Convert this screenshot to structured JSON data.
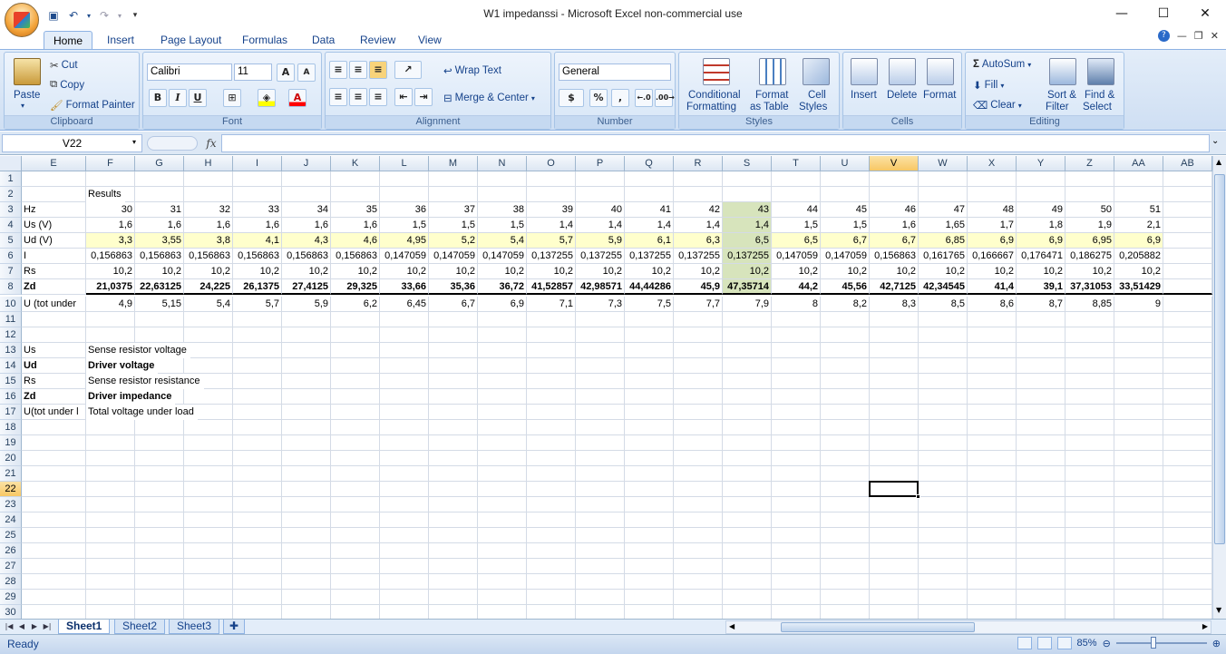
{
  "title": "W1 impedanssi - Microsoft Excel non-commercial use",
  "ribbon_tabs": [
    "Home",
    "Insert",
    "Page Layout",
    "Formulas",
    "Data",
    "Review",
    "View"
  ],
  "ribbon": {
    "clipboard": {
      "paste": "Paste",
      "cut": "Cut",
      "copy": "Copy",
      "format_painter": "Format Painter",
      "label": "Clipboard"
    },
    "font": {
      "name": "Calibri",
      "size": "11",
      "label": "Font",
      "bold": "B",
      "italic": "I",
      "underline": "U",
      "grow": "A",
      "shrink": "A",
      "color_letter": "A"
    },
    "alignment": {
      "wrap": "Wrap Text",
      "merge": "Merge & Center",
      "label": "Alignment"
    },
    "number": {
      "format": "General",
      "percent": "%",
      "comma": ",",
      "label": "Number"
    },
    "styles": {
      "conditional1": "Conditional",
      "conditional2": "Formatting",
      "table1": "Format",
      "table2": "as Table",
      "cell1": "Cell",
      "cell2": "Styles",
      "label": "Styles"
    },
    "cells": {
      "insert": "Insert",
      "delete": "Delete",
      "format": "Format",
      "label": "Cells"
    },
    "editing": {
      "autosum": "AutoSum",
      "fill": "Fill",
      "clear": "Clear",
      "sort1": "Sort &",
      "sort2": "Filter",
      "find1": "Find &",
      "find2": "Select",
      "label": "Editing"
    }
  },
  "name_box": "V22",
  "fx_label": "fx",
  "columns": [
    "E",
    "F",
    "G",
    "H",
    "I",
    "J",
    "K",
    "L",
    "M",
    "N",
    "O",
    "P",
    "Q",
    "R",
    "S",
    "T",
    "U",
    "V",
    "W",
    "X",
    "Y",
    "Z",
    "AA",
    "AB"
  ],
  "selected_column": "V",
  "selected_row": "22",
  "rows": [
    {
      "n": "1",
      "label": "",
      "vals": []
    },
    {
      "n": "2",
      "label": "",
      "vals": []
    },
    {
      "n": "3",
      "label": "Hz",
      "vals": [
        "30",
        "31",
        "32",
        "33",
        "34",
        "35",
        "36",
        "37",
        "38",
        "39",
        "40",
        "41",
        "42",
        "43",
        "44",
        "45",
        "46",
        "47",
        "48",
        "49",
        "50",
        "51"
      ]
    },
    {
      "n": "4",
      "label": "Us (V)",
      "vals": [
        "1,6",
        "1,6",
        "1,6",
        "1,6",
        "1,6",
        "1,6",
        "1,5",
        "1,5",
        "1,5",
        "1,4",
        "1,4",
        "1,4",
        "1,4",
        "1,4",
        "1,5",
        "1,5",
        "1,6",
        "1,65",
        "1,7",
        "1,8",
        "1,9",
        "2,1"
      ]
    },
    {
      "n": "5",
      "label": "Ud (V)",
      "vals": [
        "3,3",
        "3,55",
        "3,8",
        "4,1",
        "4,3",
        "4,6",
        "4,95",
        "5,2",
        "5,4",
        "5,7",
        "5,9",
        "6,1",
        "6,3",
        "6,5",
        "6,5",
        "6,7",
        "6,7",
        "6,85",
        "6,9",
        "6,9",
        "6,95",
        "6,9"
      ]
    },
    {
      "n": "6",
      "label": "I",
      "vals": [
        "0,156863",
        "0,156863",
        "0,156863",
        "0,156863",
        "0,156863",
        "0,156863",
        "0,147059",
        "0,147059",
        "0,147059",
        "0,137255",
        "0,137255",
        "0,137255",
        "0,137255",
        "0,137255",
        "0,147059",
        "0,147059",
        "0,156863",
        "0,161765",
        "0,166667",
        "0,176471",
        "0,186275",
        "0,205882"
      ]
    },
    {
      "n": "7",
      "label": "Rs",
      "vals": [
        "10,2",
        "10,2",
        "10,2",
        "10,2",
        "10,2",
        "10,2",
        "10,2",
        "10,2",
        "10,2",
        "10,2",
        "10,2",
        "10,2",
        "10,2",
        "10,2",
        "10,2",
        "10,2",
        "10,2",
        "10,2",
        "10,2",
        "10,2",
        "10,2",
        "10,2"
      ]
    },
    {
      "n": "8",
      "label": "Zd",
      "vals": [
        "21,0375",
        "22,63125",
        "24,225",
        "26,1375",
        "27,4125",
        "29,325",
        "33,66",
        "35,36",
        "36,72",
        "41,52857",
        "42,98571",
        "44,44286",
        "45,9",
        "47,35714",
        "44,2",
        "45,56",
        "42,7125",
        "42,34545",
        "41,4",
        "39,1",
        "37,31053",
        "33,51429"
      ]
    },
    {
      "n": "10",
      "label": "U (tot under",
      "vals": [
        "4,9",
        "5,15",
        "5,4",
        "5,7",
        "5,9",
        "6,2",
        "6,45",
        "6,7",
        "6,9",
        "7,1",
        "7,3",
        "7,5",
        "7,7",
        "7,9",
        "8",
        "8,2",
        "8,3",
        "8,5",
        "8,6",
        "8,7",
        "8,85",
        "9"
      ]
    },
    {
      "n": "11",
      "label": "",
      "vals": []
    },
    {
      "n": "12",
      "label": "",
      "vals": []
    },
    {
      "n": "13",
      "label": "Us",
      "vals": []
    },
    {
      "n": "14",
      "label": "Ud",
      "vals": []
    },
    {
      "n": "15",
      "label": "Rs",
      "vals": []
    },
    {
      "n": "16",
      "label": "Zd",
      "vals": []
    },
    {
      "n": "17",
      "label": "U(tot under l",
      "vals": []
    },
    {
      "n": "18",
      "label": "",
      "vals": []
    },
    {
      "n": "19",
      "label": "",
      "vals": []
    },
    {
      "n": "20",
      "label": "",
      "vals": []
    },
    {
      "n": "21",
      "label": "",
      "vals": []
    },
    {
      "n": "22",
      "label": "",
      "vals": []
    },
    {
      "n": "23",
      "label": "",
      "vals": []
    },
    {
      "n": "24",
      "label": "",
      "vals": []
    },
    {
      "n": "25",
      "label": "",
      "vals": []
    },
    {
      "n": "26",
      "label": "",
      "vals": []
    },
    {
      "n": "27",
      "label": "",
      "vals": []
    },
    {
      "n": "28",
      "label": "",
      "vals": []
    },
    {
      "n": "29",
      "label": "",
      "vals": []
    },
    {
      "n": "30",
      "label": "",
      "vals": []
    }
  ],
  "f_column_text": {
    "2": "Results",
    "13": "Sense resistor voltage",
    "14": "Driver voltage",
    "15": "Sense resistor resistance",
    "16": "Driver impedance",
    "17": "Total voltage under load"
  },
  "bold_rows": [
    "8",
    "14",
    "16"
  ],
  "sheets": [
    "Sheet1",
    "Sheet2",
    "Sheet3"
  ],
  "active_sheet": "Sheet1",
  "status": "Ready",
  "zoom": "85%",
  "colors": {
    "highlight_yellow": "#ffffcc",
    "highlight_green": "#d7e4bc",
    "selected_header": "#f8c764"
  }
}
